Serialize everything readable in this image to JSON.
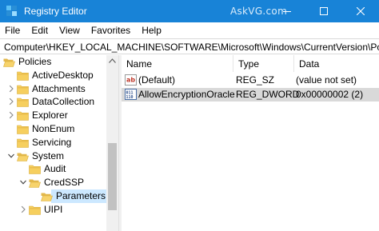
{
  "window": {
    "title": "Registry Editor",
    "watermark": "AskVG.com",
    "accent": "#1883d7"
  },
  "menu": [
    "File",
    "Edit",
    "View",
    "Favorites",
    "Help"
  ],
  "address": "Computer\\HKEY_LOCAL_MACHINE\\SOFTWARE\\Microsoft\\Windows\\CurrentVersion\\Policies\\",
  "tree": {
    "items": [
      {
        "label": "Policies",
        "expanded": true
      },
      {
        "label": "ActiveDesktop"
      },
      {
        "label": "Attachments"
      },
      {
        "label": "DataCollection"
      },
      {
        "label": "Explorer"
      },
      {
        "label": "NonEnum"
      },
      {
        "label": "Servicing"
      },
      {
        "label": "System",
        "expanded": true
      },
      {
        "label": "Audit"
      },
      {
        "label": "CredSSP",
        "expanded": true
      },
      {
        "label": "Parameters",
        "selected": true
      },
      {
        "label": "UIPI"
      }
    ]
  },
  "list": {
    "columns": [
      "Name",
      "Type",
      "Data"
    ],
    "rows": [
      {
        "icon": "string-value-icon",
        "name": "(Default)",
        "type": "REG_SZ",
        "data": "(value not set)"
      },
      {
        "icon": "dword-value-icon",
        "name": "AllowEncryptionOracle",
        "type": "REG_DWORD",
        "data": "0x00000002 (2)",
        "selected": true
      }
    ]
  }
}
